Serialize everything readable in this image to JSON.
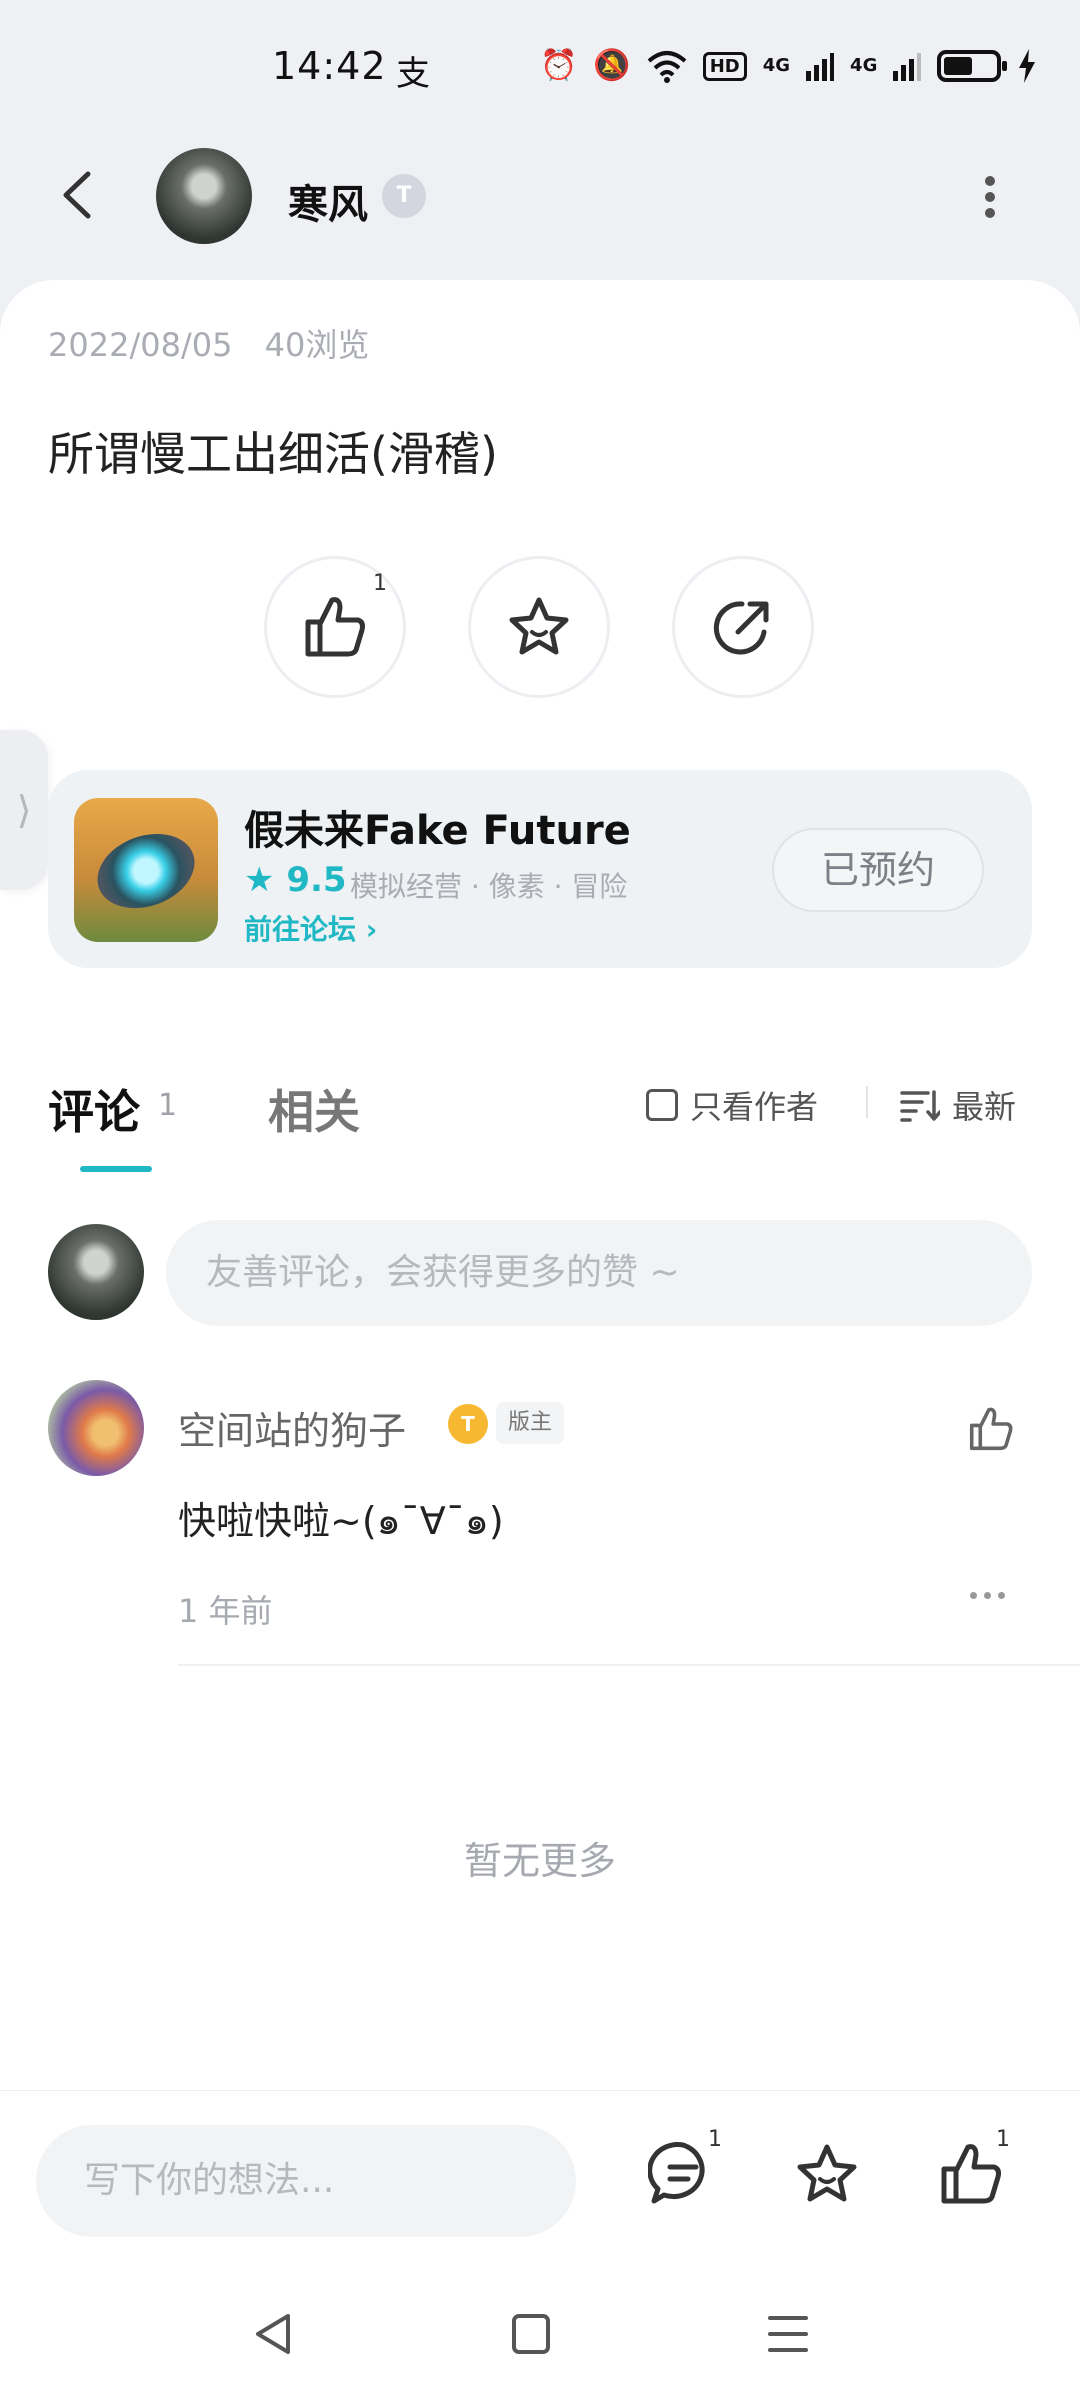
{
  "status_bar": {
    "time": "14:42",
    "left_icon": "支",
    "hd_label": "HD",
    "net1": "4G",
    "net2": "4G",
    "battery_level": 0.5
  },
  "header": {
    "username": "寒风",
    "title_badge": "T"
  },
  "post": {
    "date": "2022/08/05",
    "views": "40浏览",
    "title": "所谓慢工出细活(滑稽)",
    "like_count": "1"
  },
  "game": {
    "name": "假未来Fake Future",
    "rating": "9.5",
    "tags": "模拟经营 · 像素 · 冒险",
    "forum_link": "前往论坛",
    "reserve_label": "已预约"
  },
  "comments": {
    "tab_label": "评论",
    "count": "1",
    "related_tab": "相关",
    "author_only_label": "只看作者",
    "sort_label": "最新",
    "input_placeholder": "友善评论，会获得更多的赞 ~",
    "items": [
      {
        "name": "空间站的狗子",
        "badge": "T",
        "role": "版主",
        "text": "快啦快啦~(๑¯∀¯๑)",
        "time": "1 年前"
      }
    ],
    "no_more": "暂无更多"
  },
  "bottom_bar": {
    "placeholder": "写下你的想法...",
    "comment_count": "1",
    "like_count": "1"
  },
  "icons": {
    "accent": "#1fb8c4",
    "names": [
      "back-arrow-icon",
      "more-vertical-icon",
      "thumbs-up-icon",
      "star-icon",
      "share-icon",
      "chevron-right-icon",
      "sort-icon",
      "comment-icon",
      "nav-back-icon",
      "nav-home-icon",
      "nav-menu-icon"
    ]
  }
}
